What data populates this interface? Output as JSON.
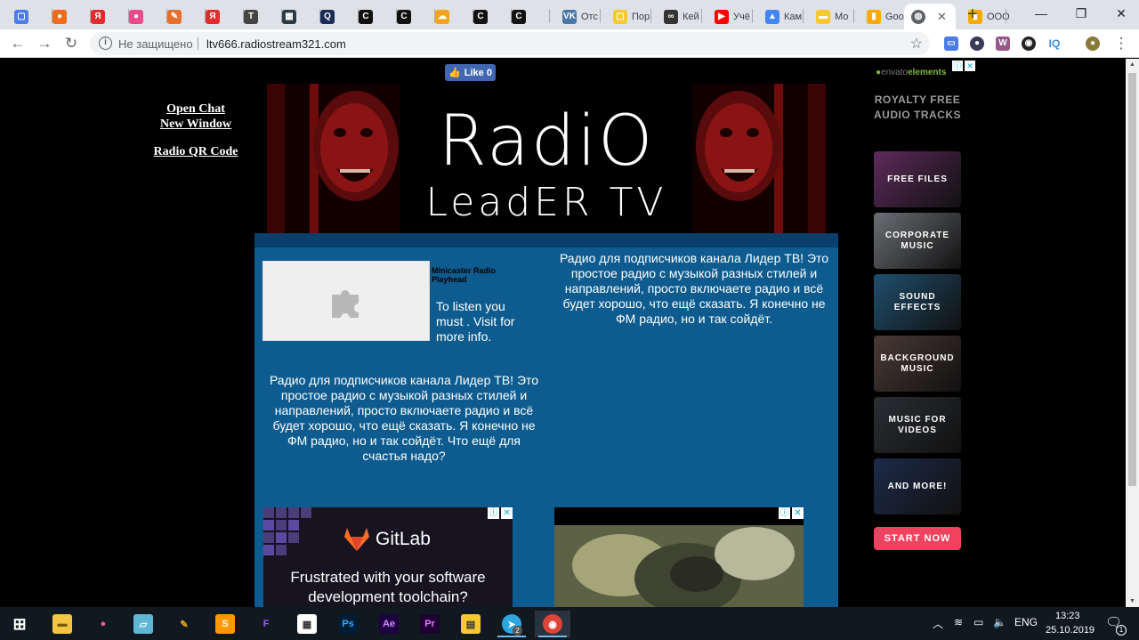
{
  "browser": {
    "tabs": [
      {
        "label": "",
        "favicon": "chat-icon",
        "color": "#4a7be8",
        "glyph": "▢"
      },
      {
        "label": "",
        "favicon": "fire-icon",
        "color": "#f26b1d",
        "glyph": "●"
      },
      {
        "label": "",
        "favicon": "yandex-icon",
        "color": "#e32c2c",
        "glyph": "Я"
      },
      {
        "label": "",
        "favicon": "ball-icon",
        "color": "#ea4c89",
        "glyph": "●"
      },
      {
        "label": "",
        "favicon": "note-icon",
        "color": "#e76f2c",
        "glyph": "✎"
      },
      {
        "label": "",
        "favicon": "yandex-icon",
        "color": "#e32c2c",
        "glyph": "Я"
      },
      {
        "label": "",
        "favicon": "t-icon",
        "color": "#444",
        "glyph": "T"
      },
      {
        "label": "",
        "favicon": "pixel-icon",
        "color": "#2a3b45",
        "glyph": "▦"
      },
      {
        "label": "",
        "favicon": "search-doc-icon",
        "color": "#1d2b57",
        "glyph": "Q"
      },
      {
        "label": "",
        "favicon": "c-icon",
        "color": "#111",
        "glyph": "C"
      },
      {
        "label": "",
        "favicon": "c-icon",
        "color": "#111",
        "glyph": "C"
      },
      {
        "label": "",
        "favicon": "cloud-icon",
        "color": "#f2a51c",
        "glyph": "☁"
      },
      {
        "label": "",
        "favicon": "c-icon",
        "color": "#111",
        "glyph": "C"
      },
      {
        "label": "",
        "favicon": "c-icon",
        "color": "#111",
        "glyph": "C"
      },
      {
        "label": "Отс",
        "favicon": "vk-icon",
        "color": "#4a76a8",
        "glyph": "VK"
      },
      {
        "label": "Пор",
        "favicon": "square-icon",
        "color": "#f7c92f",
        "glyph": "▢"
      },
      {
        "label": "Кей",
        "favicon": "loop-icon",
        "color": "#333",
        "glyph": "∞"
      },
      {
        "label": "Учё",
        "favicon": "youtube-icon",
        "color": "#f00",
        "glyph": "▶"
      },
      {
        "label": "Кам",
        "favicon": "ads-icon",
        "color": "#4285f4",
        "glyph": "▲"
      },
      {
        "label": "Мо",
        "favicon": "comment-icon",
        "color": "#f7c92f",
        "glyph": "▬"
      },
      {
        "label": "Goo",
        "favicon": "analytics-icon",
        "color": "#f9ab00",
        "glyph": "▮"
      },
      {
        "label": "Goo",
        "favicon": "analytics-icon",
        "color": "#f9ab00",
        "glyph": "▮"
      },
      {
        "label": "ООО",
        "favicon": "analytics-icon",
        "color": "#f9ab00",
        "glyph": "▮"
      }
    ],
    "active_tab_favicon": "globe-icon",
    "address": {
      "security_label": "Не защищено",
      "url": "ltv666.radiostream321.com"
    }
  },
  "page": {
    "left_links": {
      "open_chat": "Open Chat",
      "new_window": "New Window",
      "qr_code": "Radio QR Code"
    },
    "fb_like": {
      "label": "Like 0"
    },
    "banner": {
      "line1": "RadiO",
      "line2": "LeadER TV"
    },
    "player": {
      "title": "Minicaster Radio Playhead",
      "message": "To listen you must . Visit for more info."
    },
    "description_left": "Радио для подписчиков канала Лидер ТВ! Это простое радио с музыкой разных стилей и направлений, просто включаете радио и всё будет хорошо, что ещё сказать. Я конечно не ФМ радио, но и так сойдёт. Что ещё для счастья надо?",
    "description_right": "Радио для подписчиков канала Лидер ТВ! Это простое радио с музыкой разных стилей и направлений, просто включаете радио и всё будет хорошо, что ещё сказать. Я конечно не ФМ радио, но и так сойдёт.",
    "ad_gitlab": {
      "brand": "GitLab",
      "text": "Frustrated with your software development toolchain?"
    },
    "ad_envato": {
      "logo_prefix": "envato",
      "logo_suffix": "elements",
      "headline": "ROYALTY FREE AUDIO TRACKS",
      "tiles": [
        {
          "label": "FREE FILES",
          "color": "#5e2a5c"
        },
        {
          "label": "CORPORATE MUSIC",
          "color": "#6b6e73"
        },
        {
          "label": "SOUND EFFECTS",
          "color": "#1f4f6e"
        },
        {
          "label": "BACKGROUND MUSIC",
          "color": "#4a3a34"
        },
        {
          "label": "MUSIC FOR VIDEOS",
          "color": "#2a2e33"
        },
        {
          "label": "AND MORE!",
          "color": "#1c2a4a"
        }
      ],
      "cta": "START NOW"
    }
  },
  "taskbar": {
    "apps": [
      {
        "name": "windows-start-icon",
        "glyph": "⊞",
        "bg": "transparent",
        "fg": "#fff"
      },
      {
        "name": "file-explorer-icon",
        "glyph": "▬",
        "bg": "#f4c542",
        "fg": "#7a5c00"
      },
      {
        "name": "maps-pin-icon",
        "glyph": "●",
        "bg": "transparent",
        "fg": "#e85d9c"
      },
      {
        "name": "notes-icon",
        "glyph": "▱",
        "bg": "#5fb7d4",
        "fg": "#fff"
      },
      {
        "name": "paint-icon",
        "glyph": "✎",
        "bg": "transparent",
        "fg": "#f2a51c"
      },
      {
        "name": "sublime-icon",
        "glyph": "S",
        "bg": "#ff9800",
        "fg": "#fff"
      },
      {
        "name": "figma-icon",
        "glyph": "F",
        "bg": "transparent",
        "fg": "#a259ff"
      },
      {
        "name": "calculator-icon",
        "glyph": "▦",
        "bg": "#fff",
        "fg": "#333"
      },
      {
        "name": "photoshop-icon",
        "glyph": "Ps",
        "bg": "#001d34",
        "fg": "#31a8ff"
      },
      {
        "name": "after-effects-icon",
        "glyph": "Ae",
        "bg": "#1f0040",
        "fg": "#d291ff"
      },
      {
        "name": "premiere-icon",
        "glyph": "Pr",
        "bg": "#1e0033",
        "fg": "#e579ff"
      },
      {
        "name": "sticky-note-icon",
        "glyph": "▤",
        "bg": "#f7c92f",
        "fg": "#333"
      },
      {
        "name": "telegram-icon",
        "glyph": "➤",
        "bg": "#2ca5e0",
        "fg": "#fff"
      },
      {
        "name": "chrome-icon",
        "glyph": "◉",
        "bg": "#db4437",
        "fg": "#fff"
      }
    ],
    "telegram_badge": "2",
    "language": "ENG",
    "time": "13:23",
    "date": "25.10.2019",
    "notification_count": "1"
  }
}
